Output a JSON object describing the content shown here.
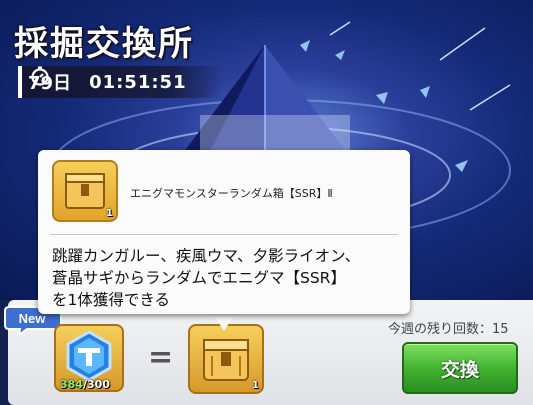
{
  "header": {
    "title": "採掘交換所",
    "timer_days": "79日",
    "timer_clock": "01:51:51"
  },
  "tooltip": {
    "item_name": "エニグマモンスターランダム箱【SSR】Ⅱ",
    "item_count": "1",
    "description_lines": [
      "跳躍カンガルー、疾風ウマ、夕影ライオン、",
      "蒼晶サギからランダムでエニグマ【SSR】",
      "を1体獲得できる"
    ]
  },
  "exchange": {
    "new_badge": "New",
    "remaining_label": "今週の残り回数：15",
    "medal_have": "384",
    "medal_need": "/300",
    "equals": "=",
    "reward_count": "1",
    "button_label": "交換"
  },
  "colors": {
    "button_green": "#3fb02f",
    "medal_have_green": "#8ff06a",
    "box_gold": "#e1a42b"
  }
}
